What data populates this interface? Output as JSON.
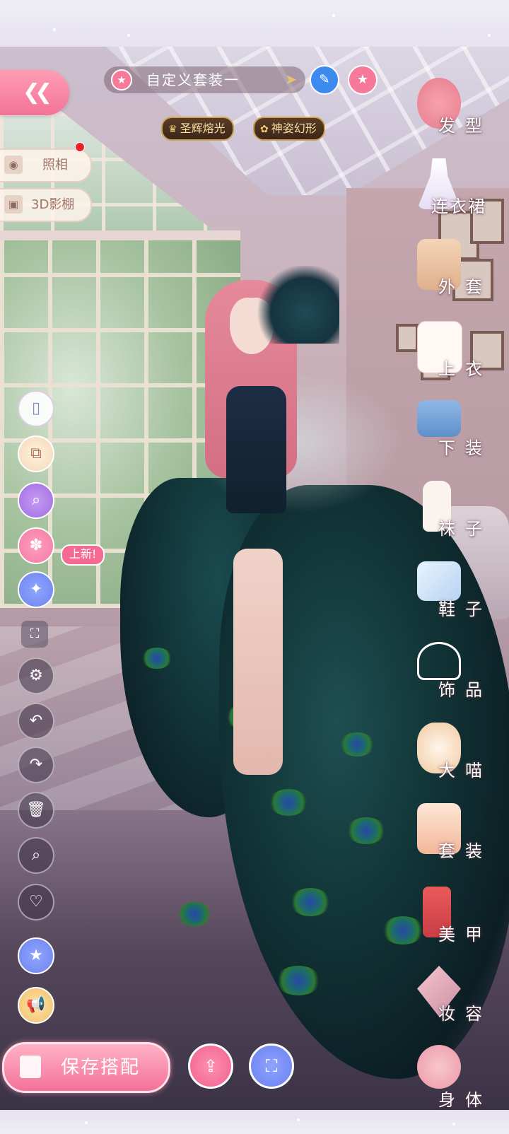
{
  "top_bar": {
    "back_icon": "double-chevron-left-icon",
    "outfit_name": "自定义套装一",
    "outfit_star_icon": "star-icon",
    "arrow_icon": "arrow-right-icon",
    "edit_icon": "pencil-icon",
    "favorite_icon": "star-icon"
  },
  "skill_tags": [
    {
      "label": "圣辉熔光"
    },
    {
      "label": "神姿幻形"
    }
  ],
  "side_buttons": {
    "camera": {
      "label": "照相",
      "icon": "camera-icon"
    },
    "studio": {
      "label": "3D影棚",
      "icon": "cube-icon"
    }
  },
  "tools": [
    {
      "name": "phone-icon"
    },
    {
      "name": "copy-icon"
    },
    {
      "name": "magnify-adjust-icon"
    },
    {
      "name": "palette-icon"
    },
    {
      "name": "magic-wand-icon"
    },
    {
      "name": "fullscreen-icon"
    },
    {
      "name": "gear-icon"
    },
    {
      "name": "undo-icon"
    },
    {
      "name": "redo-icon"
    },
    {
      "name": "trash-icon"
    },
    {
      "name": "search-icon"
    },
    {
      "name": "heart-icon"
    },
    {
      "name": "star-badge-icon"
    },
    {
      "name": "megaphone-icon"
    }
  ],
  "new_badge": "上新!",
  "categories": [
    {
      "label": "发型",
      "icon": "hair-icon"
    },
    {
      "label": "连衣裙",
      "icon": "dress-icon"
    },
    {
      "label": "外套",
      "icon": "coat-icon"
    },
    {
      "label": "上衣",
      "icon": "shirt-icon"
    },
    {
      "label": "下装",
      "icon": "shorts-icon"
    },
    {
      "label": "袜子",
      "icon": "sock-icon"
    },
    {
      "label": "鞋子",
      "icon": "shoe-icon"
    },
    {
      "label": "饰品",
      "icon": "tiara-icon"
    },
    {
      "label": "大喵",
      "icon": "cat-icon"
    },
    {
      "label": "套装",
      "icon": "outfit-set-icon"
    },
    {
      "label": "美甲",
      "icon": "nail-polish-icon"
    },
    {
      "label": "妆容",
      "icon": "makeup-icon"
    },
    {
      "label": "身体",
      "icon": "body-icon"
    }
  ],
  "bottom": {
    "save_label": "保存搭配",
    "share_icon": "share-icon",
    "scan_icon": "scan-outfit-icon"
  },
  "colors": {
    "accent_pink": "#f37399",
    "tag_gold": "#c9a24f",
    "tool_purple": "#9f6de0",
    "tool_blue": "#6f83ee"
  }
}
